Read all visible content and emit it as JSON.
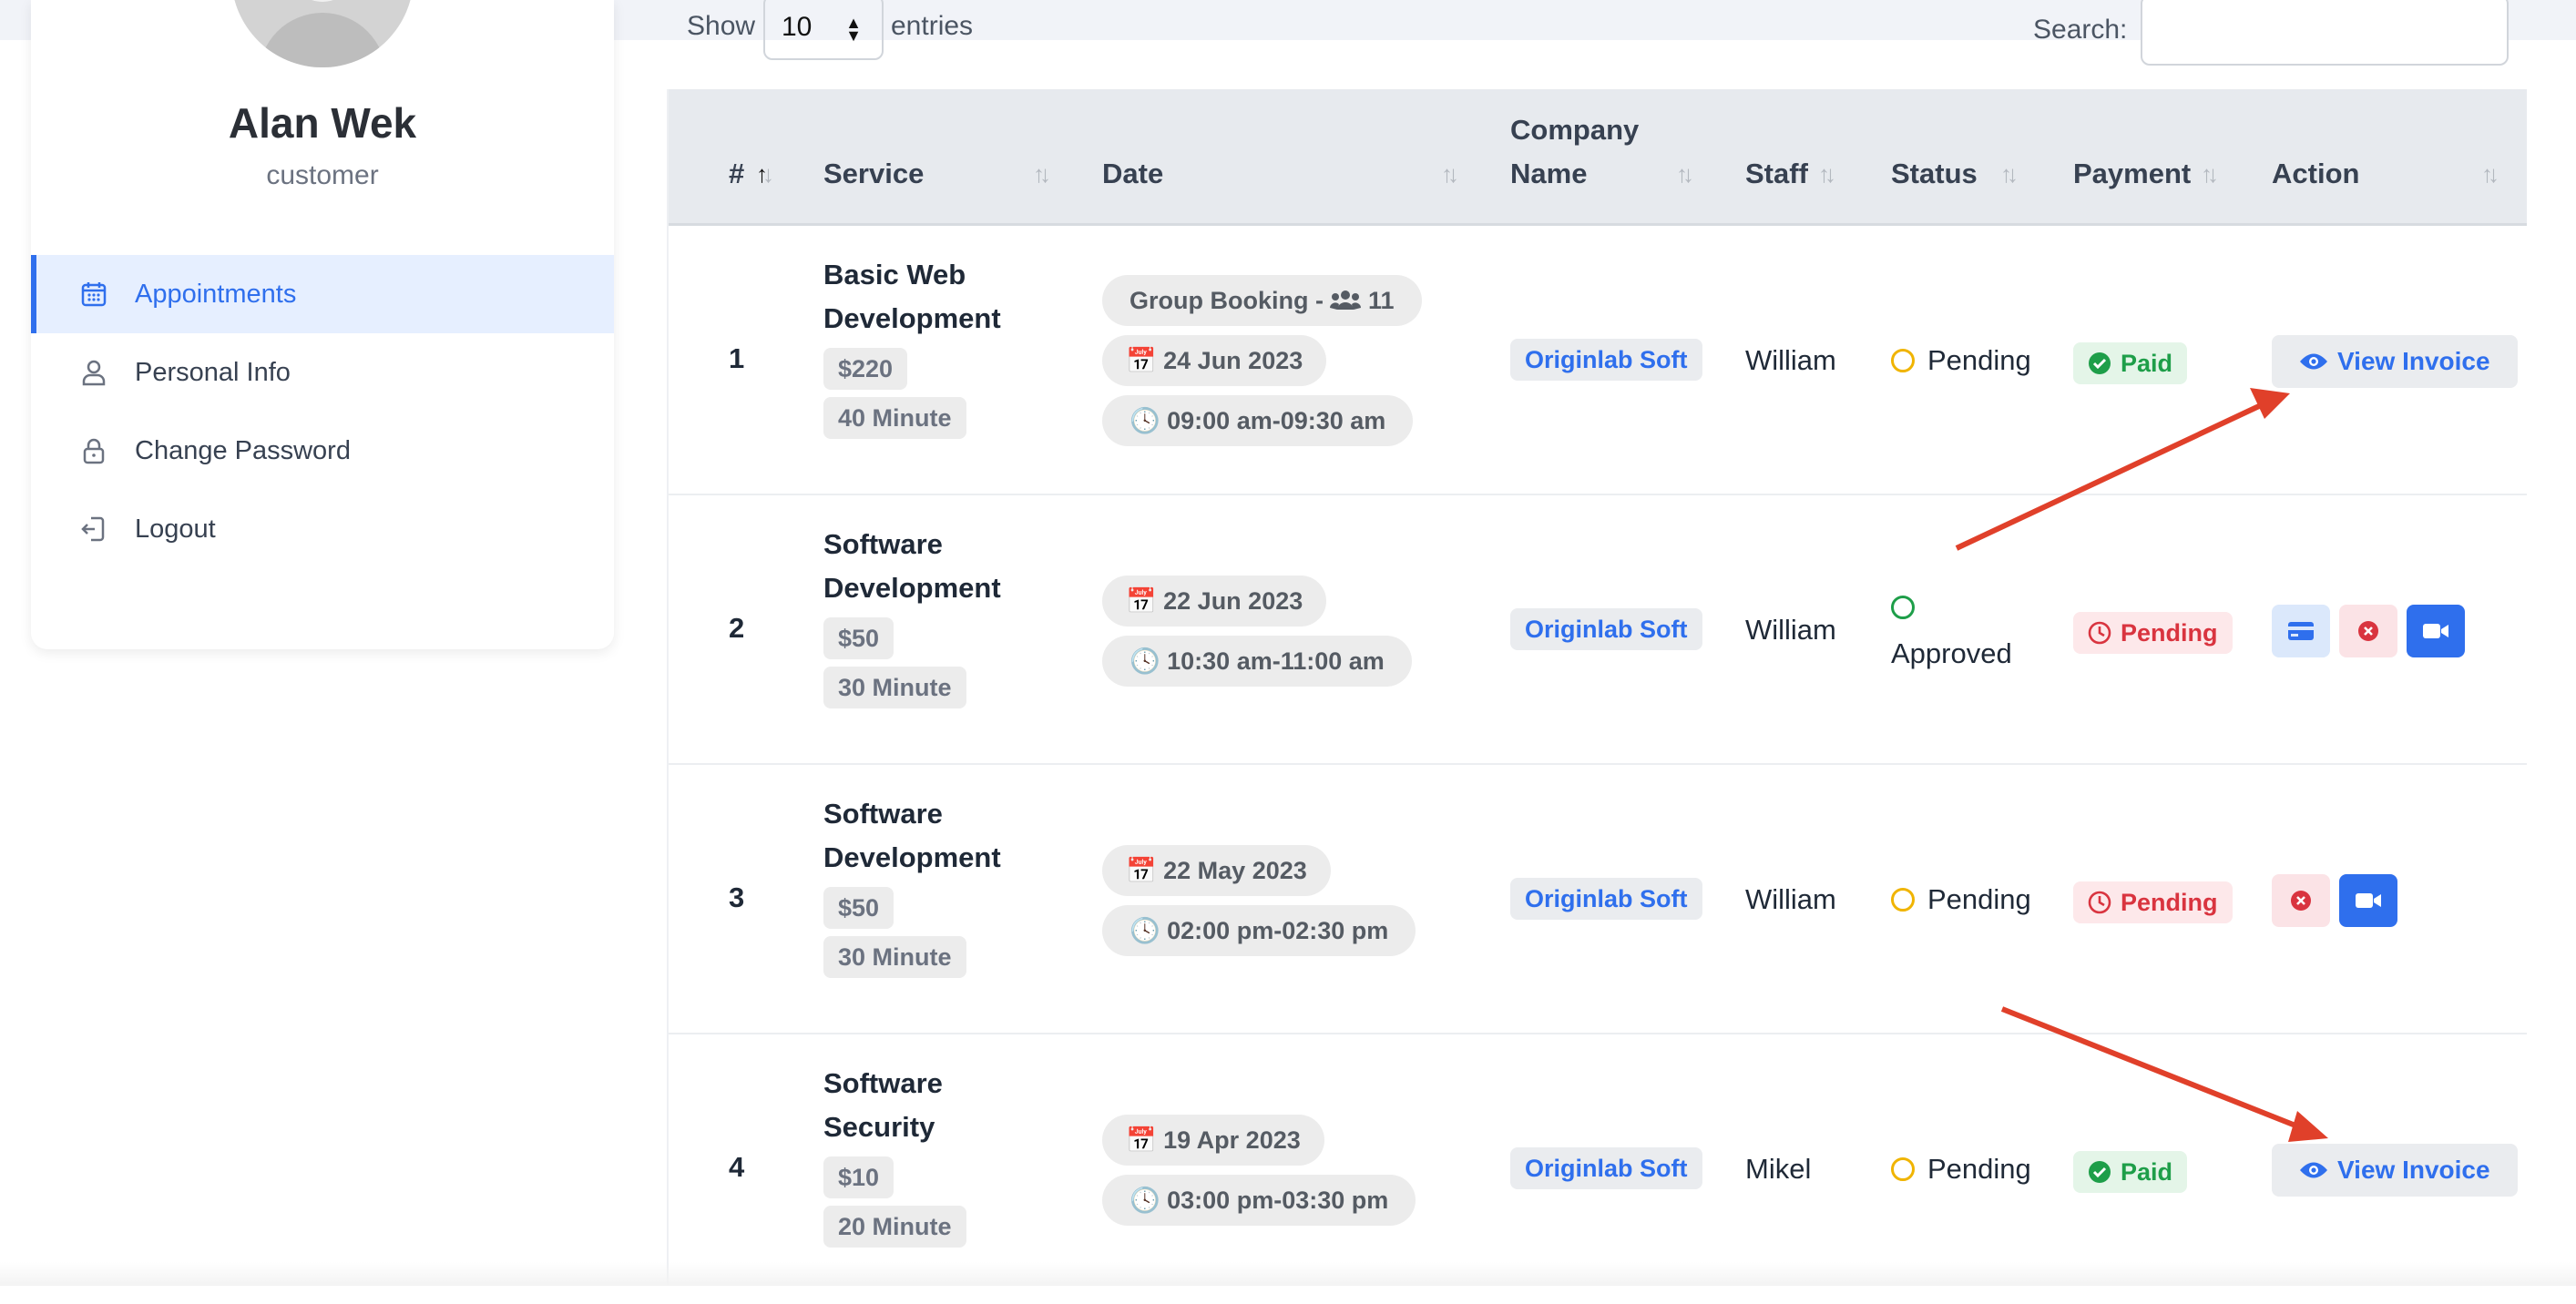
{
  "profile": {
    "name": "Alan Wek",
    "role": "customer"
  },
  "menu": {
    "items": [
      {
        "label": "Appointments",
        "icon": "calendar-icon",
        "active": true
      },
      {
        "label": "Personal Info",
        "icon": "user-icon",
        "active": false
      },
      {
        "label": "Change Password",
        "icon": "lock-icon",
        "active": false
      },
      {
        "label": "Logout",
        "icon": "logout-icon",
        "active": false
      }
    ]
  },
  "controls": {
    "show_label": "Show",
    "entries_value": "10",
    "entries_label": "entries",
    "search_label": "Search:",
    "search_value": ""
  },
  "table": {
    "headers": {
      "num": "#",
      "service": "Service",
      "date": "Date",
      "company_line1": "Company",
      "company_line2": "Name",
      "staff": "Staff",
      "status": "Status",
      "payment": "Payment",
      "action": "Action"
    },
    "rows": [
      {
        "num": "1",
        "service_line1": "Basic Web",
        "service_line2": "Development",
        "price": "$220",
        "duration": "40 Minute",
        "group_booking": "Group Booking - ",
        "group_count": "11",
        "date": "24 Jun 2023",
        "time": "09:00 am-09:30 am",
        "company": "Originlab Soft",
        "staff": "William",
        "status": "Pending",
        "payment": "Paid",
        "action_label": "View Invoice"
      },
      {
        "num": "2",
        "service_line1": "Software",
        "service_line2": "Development",
        "price": "$50",
        "duration": "30 Minute",
        "date": "22 Jun 2023",
        "time": "10:30 am-11:00 am",
        "company": "Originlab Soft",
        "staff": "William",
        "status": "Approved",
        "payment": "Pending"
      },
      {
        "num": "3",
        "service_line1": "Software",
        "service_line2": "Development",
        "price": "$50",
        "duration": "30 Minute",
        "date": "22 May 2023",
        "time": "02:00 pm-02:30 pm",
        "company": "Originlab Soft",
        "staff": "William",
        "status": "Pending",
        "payment": "Pending"
      },
      {
        "num": "4",
        "service_line1": "Software",
        "service_line2": "Security",
        "price": "$10",
        "duration": "20 Minute",
        "date": "19 Apr 2023",
        "time": "03:00 pm-03:30 pm",
        "company": "Originlab Soft",
        "staff": "Mikel",
        "status": "Pending",
        "payment": "Paid",
        "action_label": "View Invoice"
      }
    ]
  },
  "colors": {
    "accent": "#2f6fed",
    "annotation_arrow": "#e0402a",
    "pending_ring": "#f0b400",
    "approved_ring": "#1e9e49",
    "paid": "#1e9e49",
    "unpaid": "#d9343f"
  }
}
